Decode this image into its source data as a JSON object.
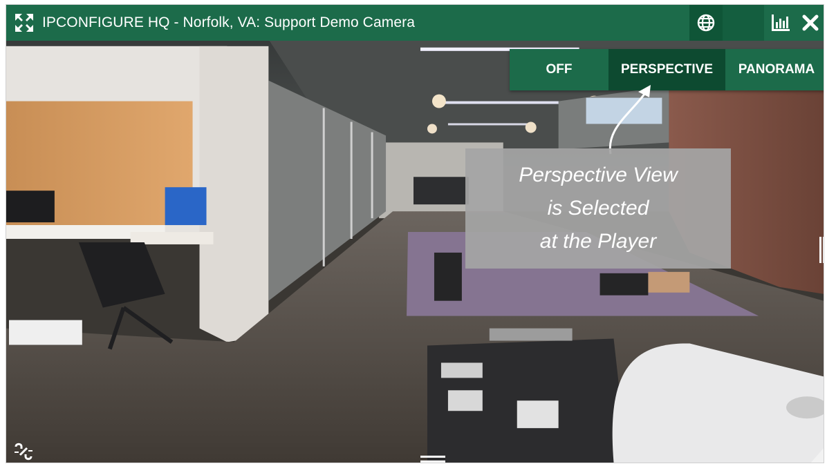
{
  "window": {
    "title": "IPCONFIGURE HQ - Norfolk, VA: Support Demo Camera"
  },
  "header": {
    "expand_icon": "expand-arrows-icon",
    "globe_icon": "globe-icon",
    "stats_icon": "bar-chart-icon",
    "close_icon": "close-x-icon"
  },
  "view_modes": {
    "off_label": "OFF",
    "perspective_label": "PERSPECTIVE",
    "panorama_label": "PANORAMA",
    "selected": "PERSPECTIVE"
  },
  "annotation": {
    "line1": "Perspective View",
    "line2": "is Selected",
    "line3": "at the Player"
  },
  "colors": {
    "header_green": "#1c6b4a",
    "selected_green": "#0d4a30",
    "callout_gray": "#a5a5a5"
  }
}
